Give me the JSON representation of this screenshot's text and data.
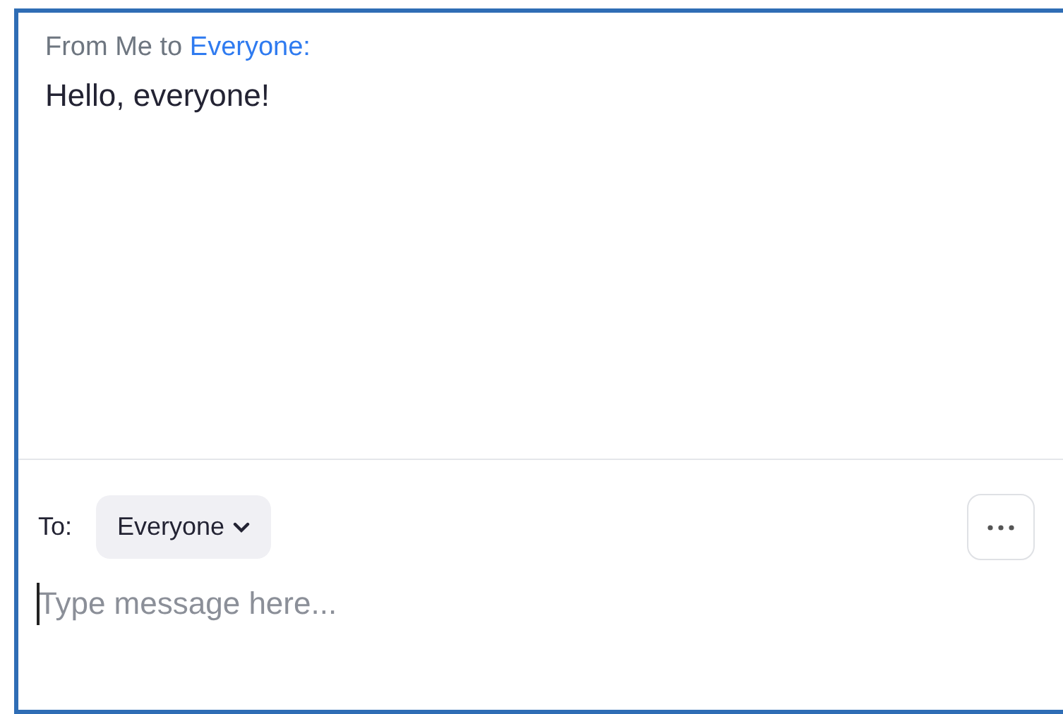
{
  "message": {
    "sender_label": "From Me to",
    "recipient": "Everyone:",
    "text": "Hello, everyone!"
  },
  "composer": {
    "to_label": "To:",
    "recipient_dropdown": "Everyone",
    "placeholder": "Type message here...",
    "focused": true
  }
}
